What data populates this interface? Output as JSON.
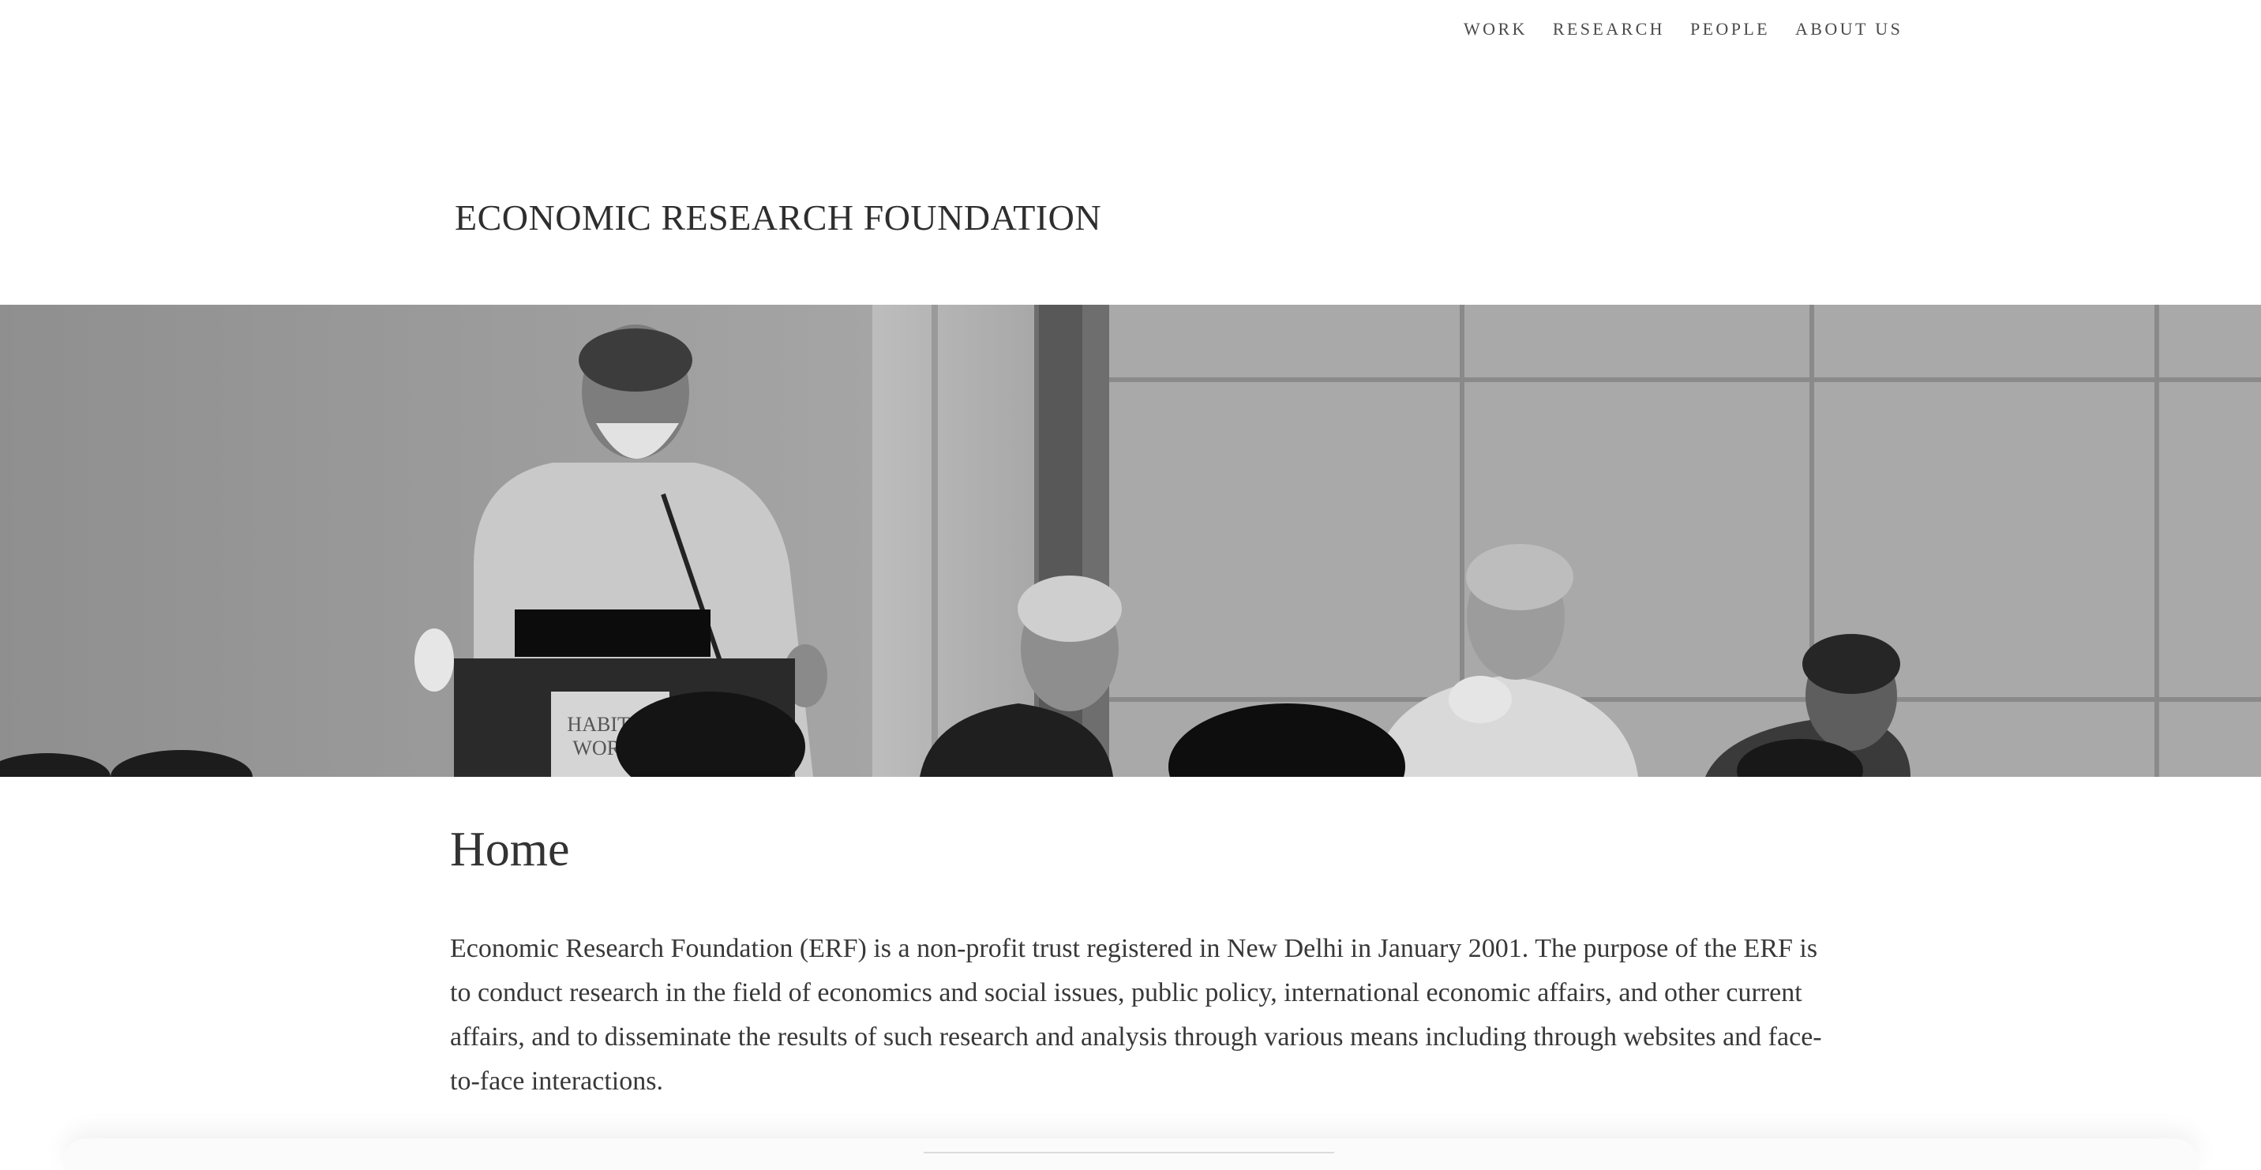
{
  "nav": {
    "items": [
      {
        "label": "WORK"
      },
      {
        "label": "RESEARCH"
      },
      {
        "label": "PEOPLE"
      },
      {
        "label": "ABOUT US"
      }
    ]
  },
  "site": {
    "title": "ECONOMIC RESEARCH FOUNDATION"
  },
  "banner": {
    "podium_sign_line1": "HABITAT",
    "podium_sign_line2": "WORLD"
  },
  "main": {
    "heading": "Home",
    "paragraph": "Economic Research Foundation (ERF) is a non-profit trust registered in New Delhi in January 2001. The purpose of the ERF is to conduct research in the field of economics and social issues, public policy, international economic affairs, and other current affairs, and to disseminate the results of such research and analysis through various means including through websites and face-to-face interactions."
  },
  "colors": {
    "text": "#333333",
    "background": "#ffffff",
    "banner_grey": "#9d9d9d"
  }
}
